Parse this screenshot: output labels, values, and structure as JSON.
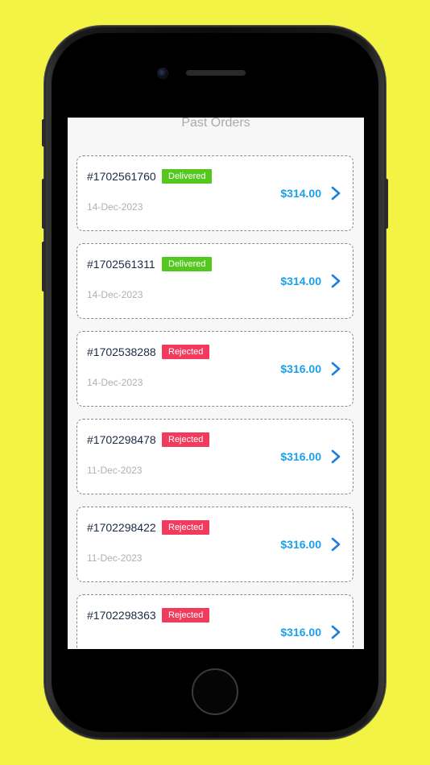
{
  "header": {
    "title": "Past Orders"
  },
  "orders": [
    {
      "id": "#1702561760",
      "status": "Delivered",
      "date": "14-Dec-2023",
      "amount": "$314.00"
    },
    {
      "id": "#1702561311",
      "status": "Delivered",
      "date": "14-Dec-2023",
      "amount": "$314.00"
    },
    {
      "id": "#1702538288",
      "status": "Rejected",
      "date": "14-Dec-2023",
      "amount": "$316.00"
    },
    {
      "id": "#1702298478",
      "status": "Rejected",
      "date": "11-Dec-2023",
      "amount": "$316.00"
    },
    {
      "id": "#1702298422",
      "status": "Rejected",
      "date": "11-Dec-2023",
      "amount": "$316.00"
    },
    {
      "id": "#1702298363",
      "status": "Rejected",
      "date": "",
      "amount": "$316.00"
    }
  ],
  "colors": {
    "background": "#f3f345",
    "delivered": "#55c81d",
    "rejected": "#f23a5c",
    "amount": "#1aa0ea",
    "chevron": "#1a7fe0"
  },
  "icons": {
    "row_action": "chevron-right-icon"
  }
}
